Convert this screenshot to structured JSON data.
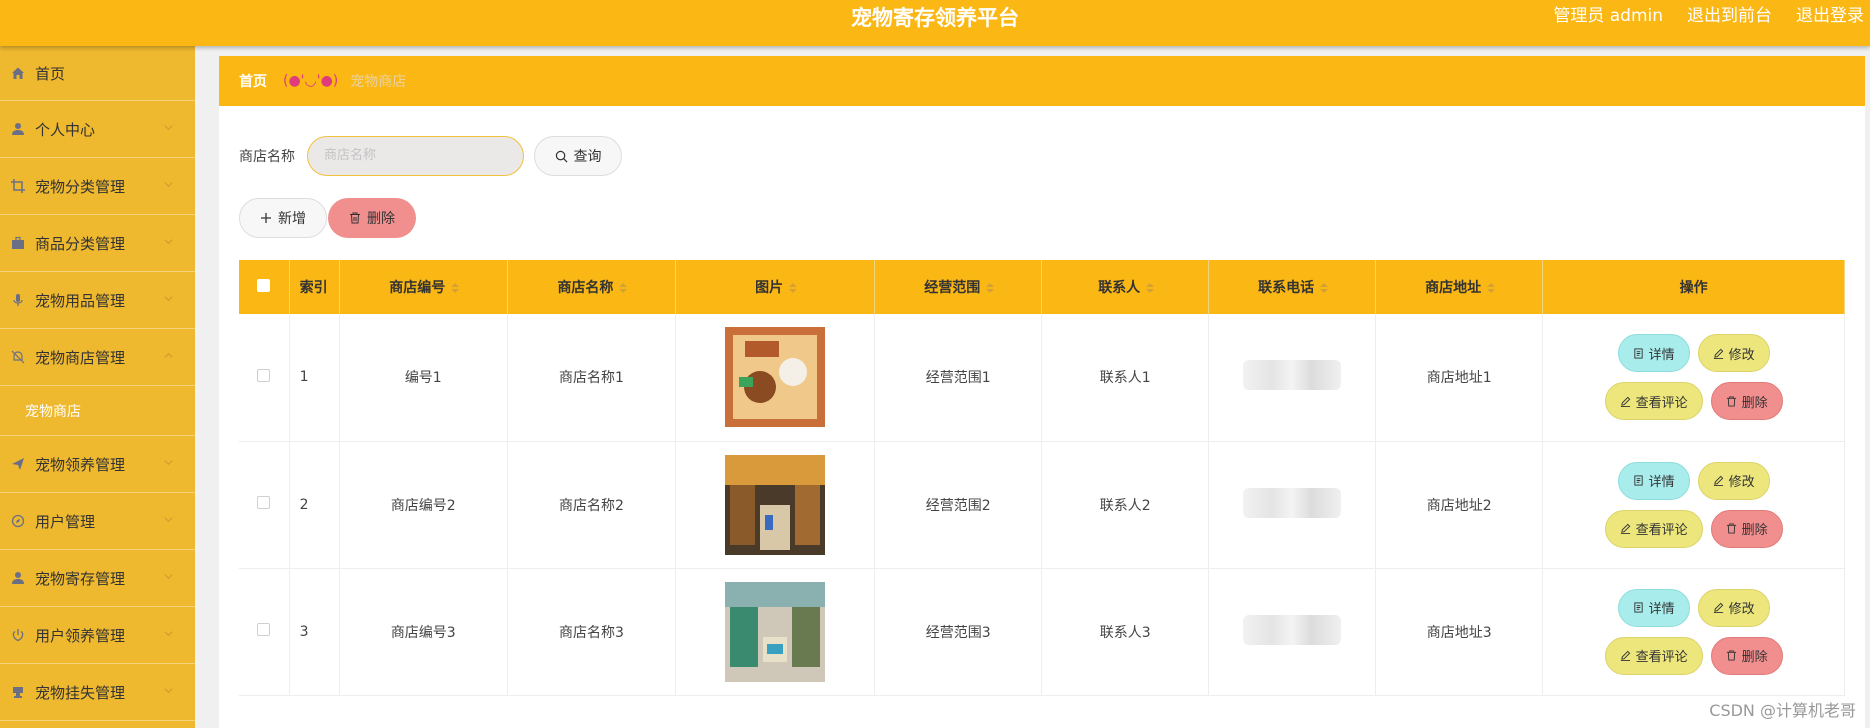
{
  "header": {
    "title": "宠物寄存领养平台",
    "admin_label": "管理员 admin",
    "to_front": "退出到前台",
    "logout": "退出登录"
  },
  "sidebar": {
    "items": [
      {
        "label": "首页",
        "icon": "home-icon"
      },
      {
        "label": "个人中心",
        "icon": "user-icon"
      },
      {
        "label": "宠物分类管理",
        "icon": "crop-icon"
      },
      {
        "label": "商品分类管理",
        "icon": "briefcase-icon"
      },
      {
        "label": "宠物用品管理",
        "icon": "microphone-icon"
      },
      {
        "label": "宠物商店管理",
        "icon": "bell-off-icon"
      },
      {
        "label": "宠物领养管理",
        "icon": "send-icon"
      },
      {
        "label": "用户管理",
        "icon": "compass-icon"
      },
      {
        "label": "宠物寄存管理",
        "icon": "user-icon"
      },
      {
        "label": "用户领养管理",
        "icon": "power-icon"
      },
      {
        "label": "宠物挂失管理",
        "icon": "stamp-icon"
      }
    ],
    "sub_active": "宠物商店"
  },
  "breadcrumb": {
    "home": "首页",
    "face": "(●'◡'●)",
    "current": "宠物商店"
  },
  "search": {
    "label": "商店名称",
    "placeholder": "商店名称",
    "button": "查询"
  },
  "toolbar": {
    "add": "新增",
    "delete": "删除"
  },
  "table": {
    "headers": [
      "索引",
      "商店编号",
      "商店名称",
      "图片",
      "经营范围",
      "联系人",
      "联系电话",
      "商店地址",
      "操作"
    ],
    "rows": [
      {
        "index": "1",
        "code": "编号1",
        "name": "商店名称1",
        "scope": "经营范围1",
        "contact": "联系人1",
        "address": "商店地址1"
      },
      {
        "index": "2",
        "code": "商店编号2",
        "name": "商店名称2",
        "scope": "经营范围2",
        "contact": "联系人2",
        "address": "商店地址2"
      },
      {
        "index": "3",
        "code": "商店编号3",
        "name": "商店名称3",
        "scope": "经营范围3",
        "contact": "联系人3",
        "address": "商店地址3"
      }
    ],
    "ops": {
      "detail": "详情",
      "edit": "修改",
      "review": "查看评论",
      "delete": "删除"
    }
  },
  "watermark": "CSDN @计算机老哥",
  "colors": {
    "primary": "#fbb714",
    "sidebar": "#eeb82f",
    "detail": "#a8ecec",
    "edit": "#ece67c",
    "danger": "#f18e8e"
  }
}
